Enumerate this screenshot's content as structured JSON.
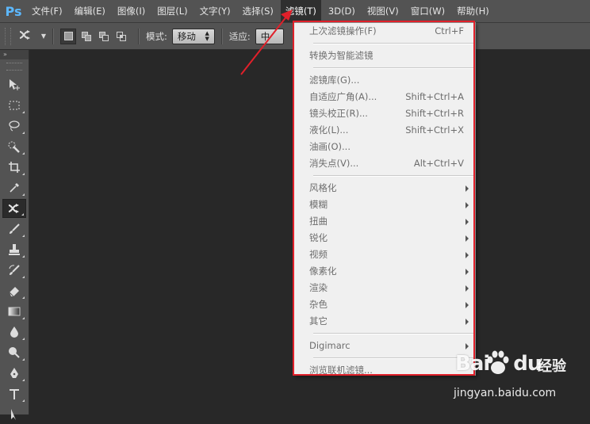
{
  "app": {
    "logo": "Ps"
  },
  "menubar": {
    "items": [
      "文件(F)",
      "编辑(E)",
      "图像(I)",
      "图层(L)",
      "文字(Y)",
      "选择(S)",
      "滤镜(T)",
      "3D(D)",
      "视图(V)",
      "窗口(W)",
      "帮助(H)"
    ],
    "active_index": 6
  },
  "options": {
    "mode_label": "模式:",
    "mode_value": "移动",
    "adapt_label": "适应:",
    "adapt_value": "中"
  },
  "toolbar": {
    "header": "»"
  },
  "filter_menu": {
    "items": [
      {
        "label": "上次滤镜操作(F)",
        "shortcut": "Ctrl+F"
      },
      {
        "type": "divider"
      },
      {
        "label": "转换为智能滤镜",
        "shortcut": ""
      },
      {
        "type": "divider"
      },
      {
        "label": "滤镜库(G)...",
        "shortcut": ""
      },
      {
        "label": "自适应广角(A)...",
        "shortcut": "Shift+Ctrl+A"
      },
      {
        "label": "镜头校正(R)...",
        "shortcut": "Shift+Ctrl+R"
      },
      {
        "label": "液化(L)...",
        "shortcut": "Shift+Ctrl+X"
      },
      {
        "label": "油画(O)...",
        "shortcut": ""
      },
      {
        "label": "消失点(V)...",
        "shortcut": "Alt+Ctrl+V"
      },
      {
        "type": "divider"
      },
      {
        "label": "风格化",
        "submenu": true
      },
      {
        "label": "模糊",
        "submenu": true
      },
      {
        "label": "扭曲",
        "submenu": true
      },
      {
        "label": "锐化",
        "submenu": true
      },
      {
        "label": "视频",
        "submenu": true
      },
      {
        "label": "像素化",
        "submenu": true
      },
      {
        "label": "渲染",
        "submenu": true
      },
      {
        "label": "杂色",
        "submenu": true
      },
      {
        "label": "其它",
        "submenu": true
      },
      {
        "type": "divider"
      },
      {
        "label": "Digimarc",
        "submenu": true
      },
      {
        "type": "divider"
      },
      {
        "label": "浏览联机滤镜...",
        "shortcut": ""
      }
    ]
  },
  "watermark": {
    "brand": "Bai",
    "brand2": "du",
    "cn": "经验",
    "url": "jingyan.baidu.com"
  },
  "colors": {
    "highlight": "#e0202a",
    "menubar": "#535353",
    "canvas": "#282828"
  }
}
